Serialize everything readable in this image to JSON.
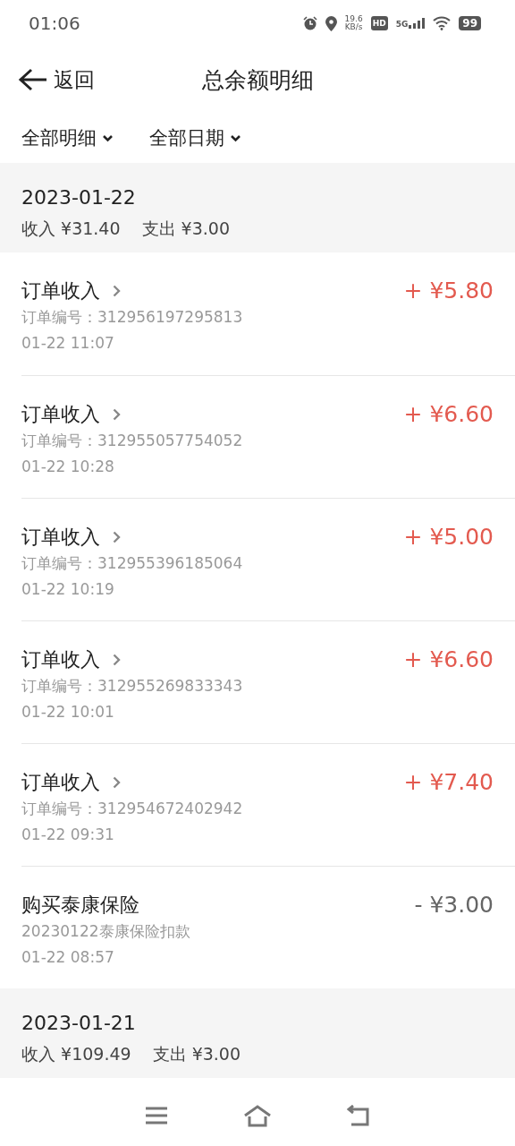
{
  "status_bar": {
    "time": "01:06",
    "speed": "19.6",
    "speed_unit": "KB/s",
    "hd": "HD",
    "network": "5G",
    "battery": "99"
  },
  "header": {
    "back": "返回",
    "title": "总余额明细"
  },
  "filters": [
    {
      "label": "全部明细"
    },
    {
      "label": "全部日期"
    }
  ],
  "groups": [
    {
      "date": "2023-01-22",
      "income": "收入 ¥31.40",
      "expense": "支出 ¥3.00",
      "entries": [
        {
          "kind": "income",
          "title": "订单收入",
          "detail": "订单编号：312956197295813",
          "time": "01-22 11:07",
          "amount": "+ ¥5.80"
        },
        {
          "kind": "income",
          "title": "订单收入",
          "detail": "订单编号：312955057754052",
          "time": "01-22 10:28",
          "amount": "+ ¥6.60"
        },
        {
          "kind": "income",
          "title": "订单收入",
          "detail": "订单编号：312955396185064",
          "time": "01-22 10:19",
          "amount": "+ ¥5.00"
        },
        {
          "kind": "income",
          "title": "订单收入",
          "detail": "订单编号：312955269833343",
          "time": "01-22 10:01",
          "amount": "+ ¥6.60"
        },
        {
          "kind": "income",
          "title": "订单收入",
          "detail": "订单编号：312954672402942",
          "time": "01-22 09:31",
          "amount": "+ ¥7.40"
        },
        {
          "kind": "expense",
          "title": "购买泰康保险",
          "detail": "20230122泰康保险扣款",
          "time": "01-22 08:57",
          "amount": "- ¥3.00"
        }
      ]
    },
    {
      "date": "2023-01-21",
      "income": "收入 ¥109.49",
      "expense": "支出 ¥3.00"
    }
  ]
}
